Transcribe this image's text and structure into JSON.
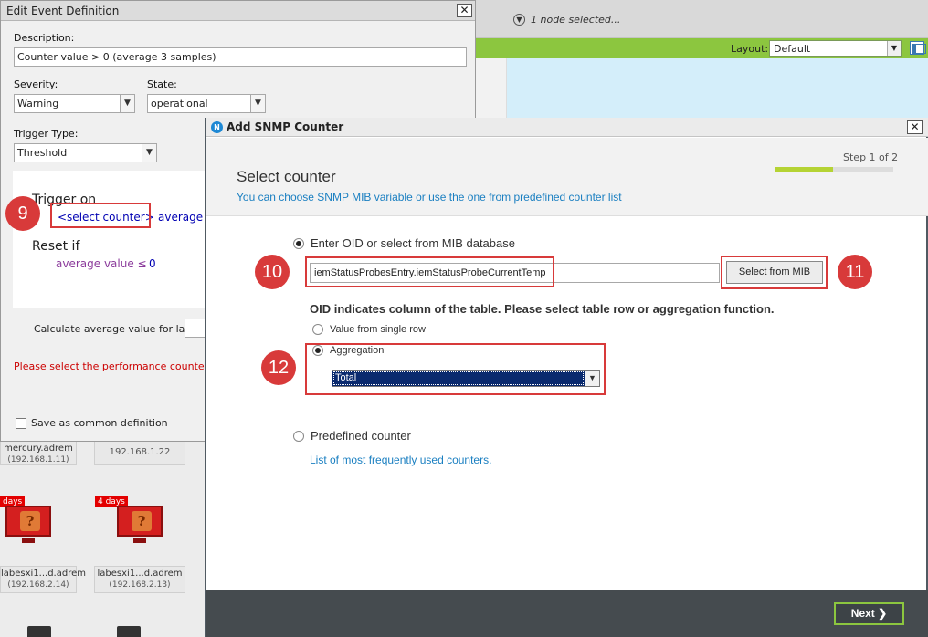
{
  "background": {
    "node_selection": "1 node selected...",
    "layout_label": "Layout:",
    "layout_value": "Default",
    "nodes": [
      {
        "name": "mercury.adrem",
        "ip": "(192.168.1.11)"
      },
      {
        "name": "",
        "ip": "192.168.1.22"
      },
      {
        "name": "labesxi1...d.adrem",
        "ip": "(192.168.2.14)",
        "badge": "days"
      },
      {
        "name": "labesxi1...d.adrem",
        "ip": "(192.168.2.13)",
        "badge": "4 days"
      }
    ]
  },
  "edit_window": {
    "title": "Edit Event Definition",
    "description_label": "Description:",
    "description_value": "Counter value  > 0 (average 3 samples)",
    "severity_label": "Severity:",
    "severity_value": "Warning",
    "state_label": "State:",
    "state_value": "operational",
    "trigger_type_label": "Trigger Type:",
    "trigger_type_value": "Threshold",
    "trigger_on": "Trigger on",
    "select_counter": "<select counter>",
    "average": "average",
    "reset_if": "Reset if",
    "reset_expr": "average value ≤",
    "reset_value": "0",
    "calc_label": "Calculate average value for last",
    "error_message": "Please select the performance counter.",
    "save_common": "Save as common definition"
  },
  "snmp_dialog": {
    "title": "Add SNMP Counter",
    "heading": "Select counter",
    "subheading": "You can choose SNMP MIB variable or use the one from predefined counter list",
    "step_label": "Step 1 of 2",
    "step_progress": 0.5,
    "option_oid": "Enter OID or select from MIB database",
    "oid_value": "iemStatusProbesEntry.iemStatusProbeCurrentTemp",
    "select_from_mib": "Select from MIB",
    "oid_note": "OID indicates column of the table. Please select table row or aggregation function.",
    "option_single_row": "Value from single row",
    "option_aggregation": "Aggregation",
    "aggregation_value": "Total",
    "option_predefined": "Predefined counter",
    "predefined_link": "List of most frequently used counters.",
    "next_label": "Next"
  },
  "annotations": [
    "9",
    "10",
    "11",
    "12"
  ],
  "colors": {
    "accent_green": "#8cc63f",
    "annotation_red": "#d83a3a",
    "link_blue": "#1a7fc1",
    "footer_dark": "#454b4f"
  }
}
